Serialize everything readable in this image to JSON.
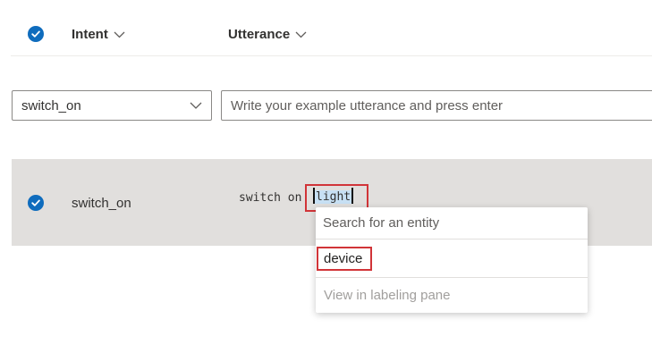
{
  "header": {
    "intent_label": "Intent",
    "utterance_label": "Utterance"
  },
  "input_row": {
    "selected_intent": "switch_on",
    "utterance_placeholder": "Write your example utterance and press enter"
  },
  "rows": [
    {
      "intent": "switch_on",
      "utterance_prefix": "switch on",
      "highlighted_word": "light"
    }
  ],
  "entity_popup": {
    "search_placeholder": "Search for an entity",
    "entities": [
      "device"
    ],
    "view_pane_link": "View in labeling pane"
  },
  "colors": {
    "accent": "#0f6cbd",
    "highlight_box": "#d13438",
    "row_selected_bg": "#e1dfdd",
    "word_highlight": "#c7e0f4"
  }
}
